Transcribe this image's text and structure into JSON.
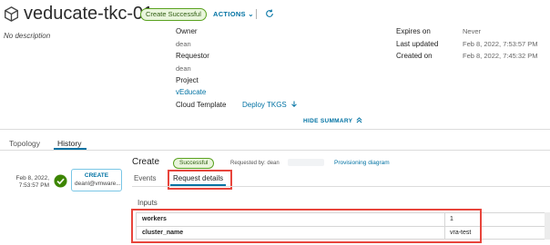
{
  "header": {
    "title": "veducate-tkc-01",
    "status": "Create Successful",
    "actions_label": "ACTIONS",
    "actions_chevron": "⌄"
  },
  "description": "No description",
  "summary": {
    "owner_label": "Owner",
    "owner_value": "dean",
    "requestor_label": "Requestor",
    "requestor_value": "dean",
    "project_label": "Project",
    "project_value": "vEducate",
    "template_label": "Cloud Template",
    "template_value": "Deploy TKGS",
    "expires_label": "Expires on",
    "expires_value": "Never",
    "updated_label": "Last updated",
    "updated_value": "Feb 8, 2022, 7:53:57 PM",
    "created_label": "Created on",
    "created_value": "Feb 8, 2022, 7:45:32 PM",
    "hide_summary": "HIDE SUMMARY"
  },
  "tabs": {
    "topology": "Topology",
    "history": "History"
  },
  "timeline": {
    "date_line1": "Feb 8, 2022,",
    "date_line2": "7:53:57 PM",
    "card_title": "CREATE",
    "card_user": "deanl@vmware..."
  },
  "event": {
    "title": "Create",
    "status": "Successful",
    "requested_by": "Requested by: dean",
    "provisioning_link": "Provisioning diagram",
    "tab_events": "Events",
    "tab_request_details": "Request details",
    "inputs_label": "Inputs",
    "inputs": [
      {
        "key": "workers",
        "value": "1"
      },
      {
        "key": "cluster_name",
        "value": "vra-test"
      }
    ]
  },
  "colors": {
    "accent": "#0072a3",
    "success": "#5aa220",
    "highlight": "#e8453c"
  },
  "icons": [
    "deployment-icon",
    "refresh-icon",
    "download-icon",
    "chevron-up-double-icon",
    "success-check-icon"
  ]
}
